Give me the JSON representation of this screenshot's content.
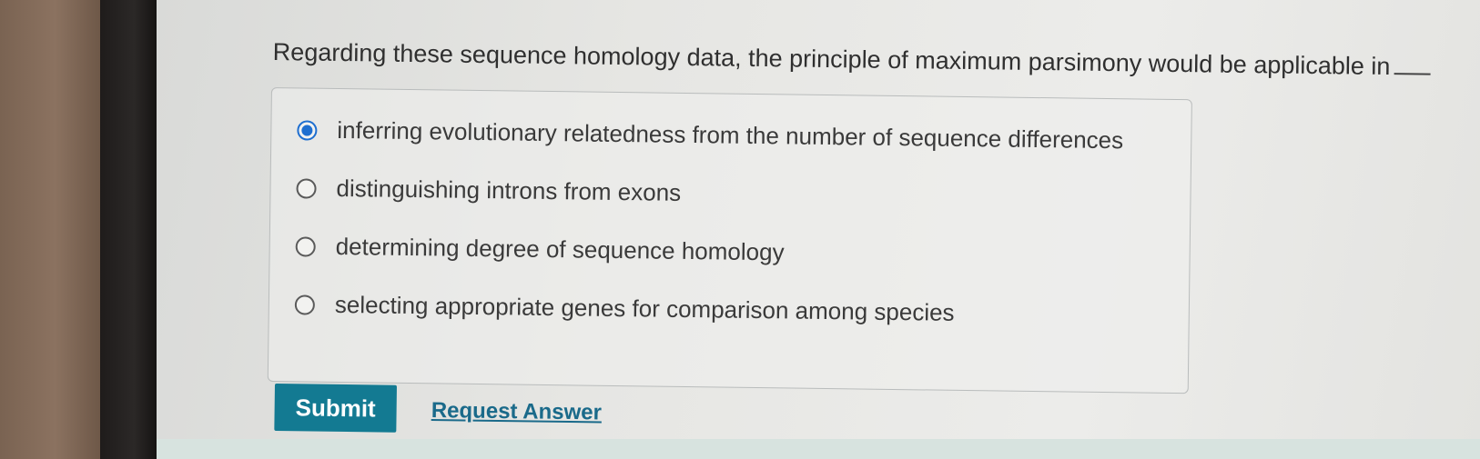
{
  "question": {
    "text": "Regarding these sequence homology data, the principle of maximum parsimony would be applicable in"
  },
  "options": [
    {
      "label": "inferring evolutionary relatedness from the number of sequence differences",
      "selected": true
    },
    {
      "label": "distinguishing introns from exons",
      "selected": false
    },
    {
      "label": "determining degree of sequence homology",
      "selected": false
    },
    {
      "label": "selecting appropriate genes for comparison among species",
      "selected": false
    }
  ],
  "actions": {
    "submit_label": "Submit",
    "request_answer_label": "Request Answer"
  },
  "colors": {
    "accent": "#1f6fd0",
    "submit_bg": "#137a92",
    "link": "#1a6a8a"
  }
}
